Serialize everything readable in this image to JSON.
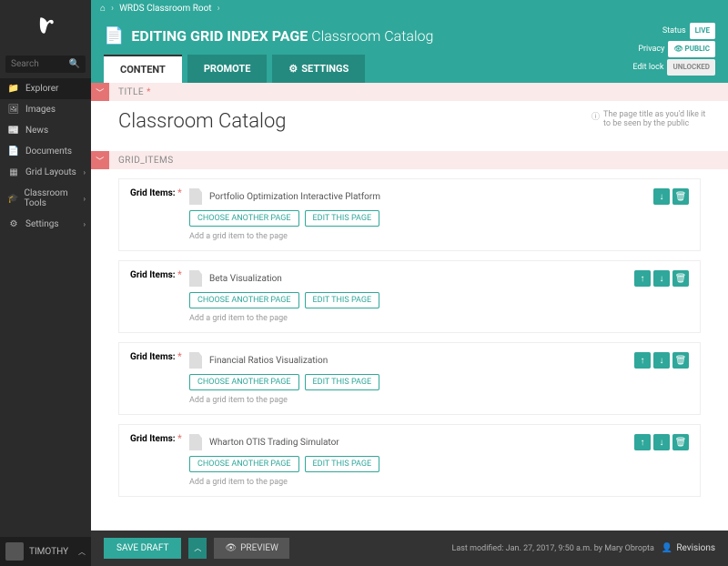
{
  "sidebar": {
    "search_placeholder": "Search",
    "nav": [
      {
        "icon": "📁",
        "label": "Explorer",
        "active": true
      },
      {
        "icon": "🖼",
        "label": "Images"
      },
      {
        "icon": "📰",
        "label": "News"
      },
      {
        "icon": "📄",
        "label": "Documents"
      },
      {
        "icon": "▦",
        "label": "Grid Layouts",
        "chev": true
      },
      {
        "icon": "🎓",
        "label": "Classroom Tools",
        "chev": true
      },
      {
        "icon": "⚙",
        "label": "Settings",
        "chev": true
      }
    ],
    "user": "TIMOTHY"
  },
  "breadcrumb": {
    "home": "⌂",
    "root": "WRDS Classroom Root"
  },
  "header": {
    "title_bold": "EDITING GRID INDEX PAGE",
    "title_light": "Classroom Catalog",
    "status_label": "Status",
    "status_val": "LIVE",
    "privacy_label": "Privacy",
    "privacy_val": "👁 PUBLIC",
    "lock_label": "Edit lock",
    "lock_val": "UNLOCKED"
  },
  "tabs": {
    "content": "CONTENT",
    "promote": "PROMOTE",
    "settings": "SETTINGS"
  },
  "sections": {
    "title_header": "TITLE",
    "title_value": "Classroom Catalog",
    "title_help": "The page title as you'd like it to be seen by the public",
    "grid_header": "GRID_ITEMS"
  },
  "grid_items": [
    {
      "label": "Grid Items:",
      "name": "Portfolio Optimization Interactive Platform",
      "up": false,
      "down": true
    },
    {
      "label": "Grid Items:",
      "name": "Beta Visualization",
      "up": true,
      "down": true
    },
    {
      "label": "Grid Items:",
      "name": "Financial Ratios Visualization",
      "up": true,
      "down": true
    },
    {
      "label": "Grid Items:",
      "name": "Wharton OTIS Trading Simulator",
      "up": true,
      "down": true
    }
  ],
  "buttons": {
    "choose": "CHOOSE ANOTHER PAGE",
    "edit": "EDIT THIS PAGE",
    "hint": "Add a grid item to the page"
  },
  "footer": {
    "save": "SAVE DRAFT",
    "preview": "PREVIEW",
    "modified": "Last modified: Jan. 27, 2017, 9:50 a.m. by Mary Obropta",
    "revisions": "Revisions"
  }
}
